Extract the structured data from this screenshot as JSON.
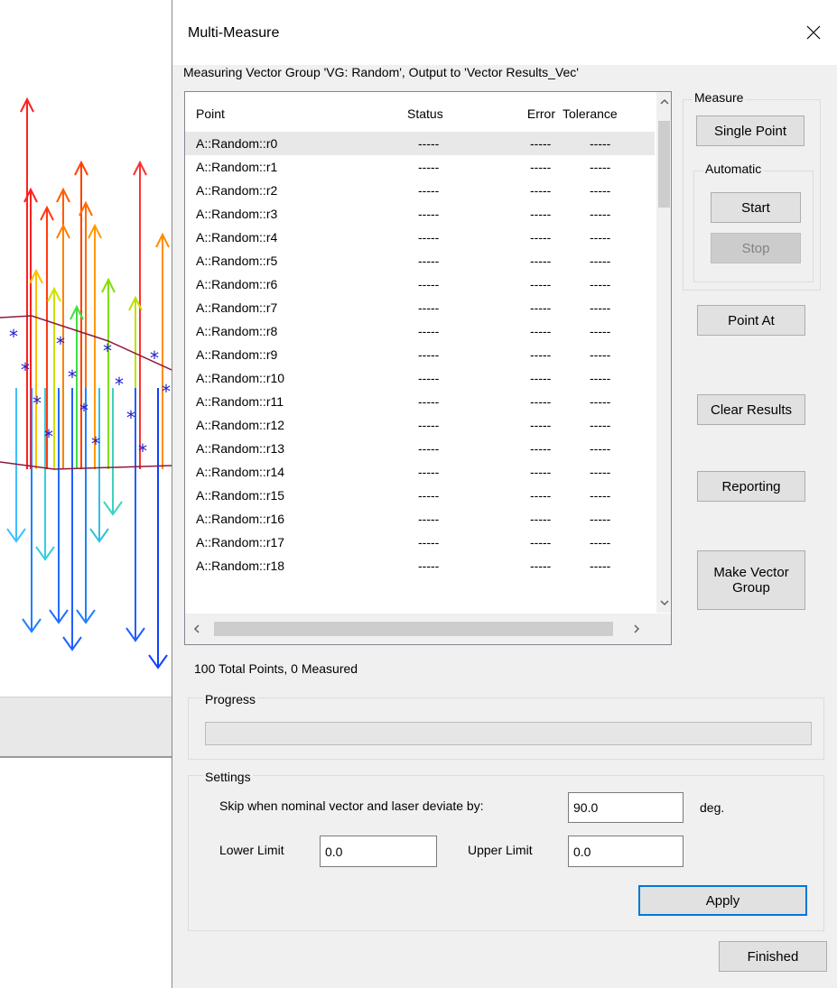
{
  "dialog": {
    "title": "Multi-Measure",
    "subtitle": "Measuring Vector Group 'VG: Random', Output to 'Vector Results_Vec'"
  },
  "list": {
    "columns": [
      "Point",
      "Status",
      "Error",
      "Tolerance"
    ],
    "rows": [
      {
        "point": "A::Random::r0",
        "status": "-----",
        "error": "-----",
        "tolerance": "-----"
      },
      {
        "point": "A::Random::r1",
        "status": "-----",
        "error": "-----",
        "tolerance": "-----"
      },
      {
        "point": "A::Random::r2",
        "status": "-----",
        "error": "-----",
        "tolerance": "-----"
      },
      {
        "point": "A::Random::r3",
        "status": "-----",
        "error": "-----",
        "tolerance": "-----"
      },
      {
        "point": "A::Random::r4",
        "status": "-----",
        "error": "-----",
        "tolerance": "-----"
      },
      {
        "point": "A::Random::r5",
        "status": "-----",
        "error": "-----",
        "tolerance": "-----"
      },
      {
        "point": "A::Random::r6",
        "status": "-----",
        "error": "-----",
        "tolerance": "-----"
      },
      {
        "point": "A::Random::r7",
        "status": "-----",
        "error": "-----",
        "tolerance": "-----"
      },
      {
        "point": "A::Random::r8",
        "status": "-----",
        "error": "-----",
        "tolerance": "-----"
      },
      {
        "point": "A::Random::r9",
        "status": "-----",
        "error": "-----",
        "tolerance": "-----"
      },
      {
        "point": "A::Random::r10",
        "status": "-----",
        "error": "-----",
        "tolerance": "-----"
      },
      {
        "point": "A::Random::r11",
        "status": "-----",
        "error": "-----",
        "tolerance": "-----"
      },
      {
        "point": "A::Random::r12",
        "status": "-----",
        "error": "-----",
        "tolerance": "-----"
      },
      {
        "point": "A::Random::r13",
        "status": "-----",
        "error": "-----",
        "tolerance": "-----"
      },
      {
        "point": "A::Random::r14",
        "status": "-----",
        "error": "-----",
        "tolerance": "-----"
      },
      {
        "point": "A::Random::r15",
        "status": "-----",
        "error": "-----",
        "tolerance": "-----"
      },
      {
        "point": "A::Random::r16",
        "status": "-----",
        "error": "-----",
        "tolerance": "-----"
      },
      {
        "point": "A::Random::r17",
        "status": "-----",
        "error": "-----",
        "tolerance": "-----"
      },
      {
        "point": "A::Random::r18",
        "status": "-----",
        "error": "-----",
        "tolerance": "-----"
      }
    ],
    "summary": "100 Total Points, 0 Measured"
  },
  "measure": {
    "group_label": "Measure",
    "single_point": "Single Point",
    "automatic_label": "Automatic",
    "start": "Start",
    "stop": "Stop"
  },
  "buttons": {
    "point_at": "Point At",
    "clear_results": "Clear Results",
    "reporting": "Reporting",
    "make_vector_group": "Make Vector Group",
    "apply": "Apply",
    "finished": "Finished"
  },
  "progress": {
    "label": "Progress",
    "value": 0
  },
  "settings": {
    "label": "Settings",
    "skip_label": "Skip when nominal vector and laser deviate by:",
    "skip_value": "90.0",
    "skip_unit": "deg.",
    "lower_label": "Lower Limit",
    "lower_value": "0.0",
    "upper_label": "Upper Limit",
    "upper_value": "0.0"
  },
  "icons": {
    "close": "close-icon",
    "scroll_up": "chevron-up-icon",
    "scroll_down": "chevron-down-icon",
    "scroll_left": "chevron-left-icon",
    "scroll_right": "chevron-right-icon"
  }
}
